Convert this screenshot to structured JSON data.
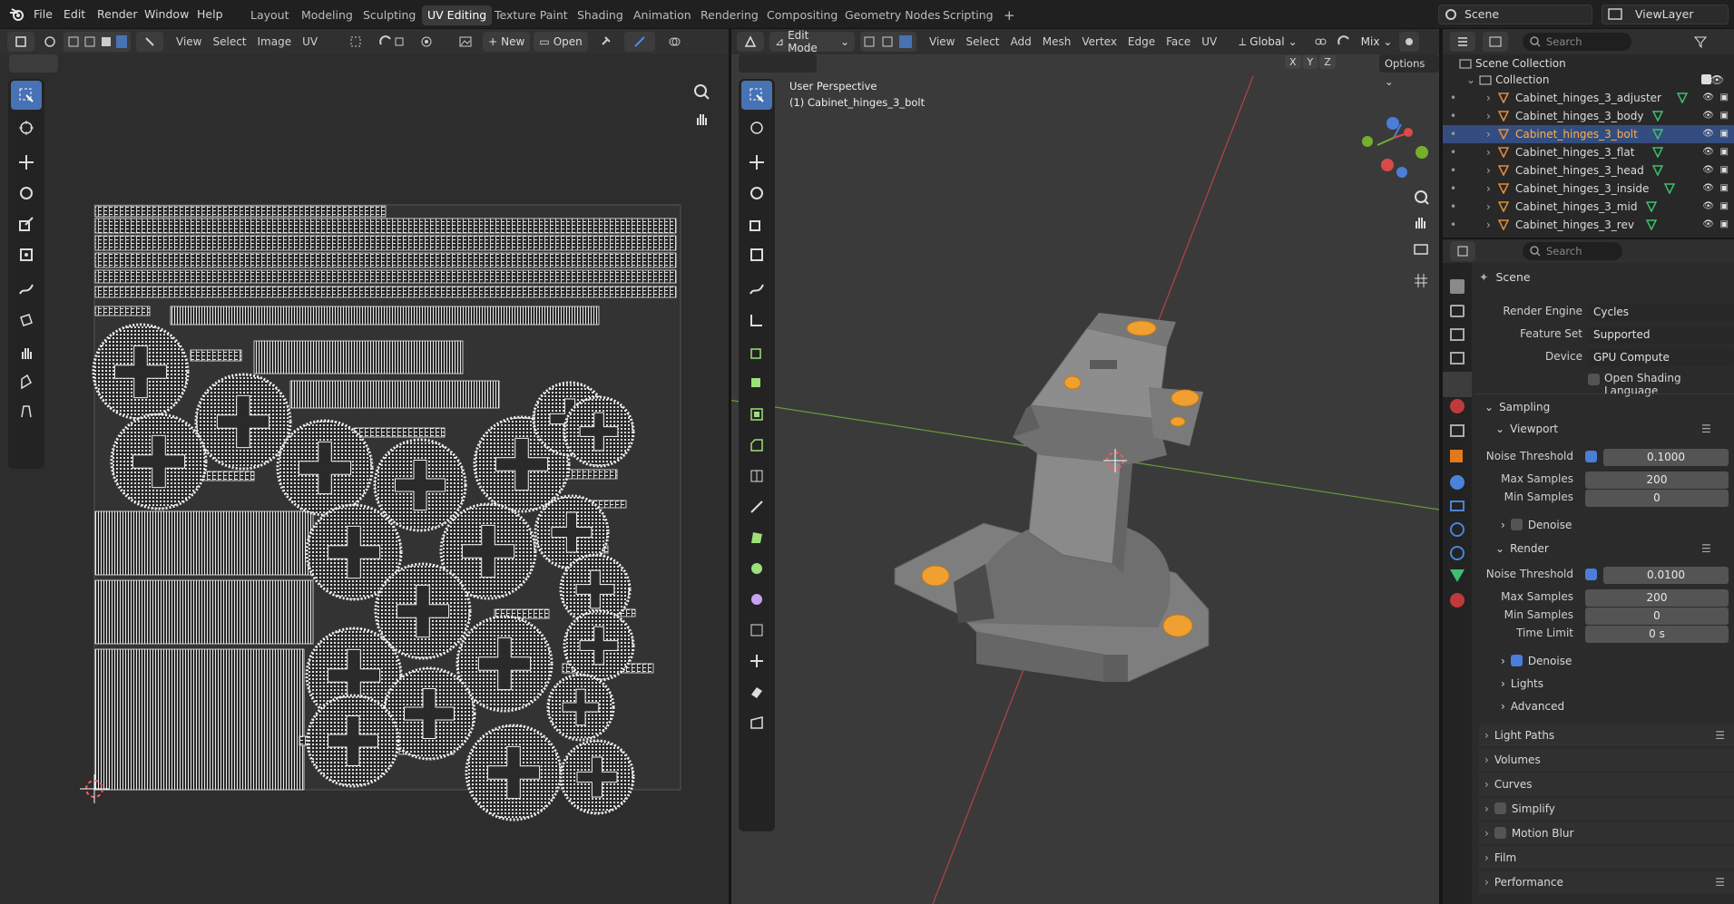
{
  "topbar": {
    "menus": [
      "File",
      "Edit",
      "Render",
      "Window",
      "Help"
    ],
    "workspaces": [
      "Layout",
      "Modeling",
      "Sculpting",
      "UV Editing",
      "Texture Paint",
      "Shading",
      "Animation",
      "Rendering",
      "Compositing",
      "Geometry Nodes",
      "Scripting"
    ],
    "active_workspace": "UV Editing",
    "add_tab": "+",
    "scene": "Scene",
    "view_layer": "ViewLayer"
  },
  "uv_editor": {
    "menus": [
      "View",
      "Select",
      "Image",
      "UV"
    ],
    "new_label": "New",
    "open_label": "Open"
  },
  "viewport": {
    "mode": "Edit Mode",
    "menus": [
      "View",
      "Select",
      "Add",
      "Mesh",
      "Vertex",
      "Edge",
      "Face",
      "UV"
    ],
    "orientation": "Global",
    "proportional_mix": "Mix",
    "options": "Options",
    "view_name": "User Perspective",
    "object_name": "(1) Cabinet_hinges_3_bolt",
    "axes": [
      "X",
      "Y",
      "Z"
    ]
  },
  "outliner": {
    "search_placeholder": "Search",
    "root": "Scene Collection",
    "collection": "Collection",
    "items": [
      {
        "name": "Cabinet_hinges_3_adjuster",
        "selected": false
      },
      {
        "name": "Cabinet_hinges_3_body",
        "selected": false
      },
      {
        "name": "Cabinet_hinges_3_bolt",
        "selected": true
      },
      {
        "name": "Cabinet_hinges_3_flat",
        "selected": false
      },
      {
        "name": "Cabinet_hinges_3_head",
        "selected": false
      },
      {
        "name": "Cabinet_hinges_3_inside",
        "selected": false
      },
      {
        "name": "Cabinet_hinges_3_mid",
        "selected": false
      },
      {
        "name": "Cabinet_hinges_3_rev",
        "selected": false
      }
    ]
  },
  "properties": {
    "search_placeholder": "Search",
    "context": "Scene",
    "render_engine_label": "Render Engine",
    "render_engine": "Cycles",
    "feature_set_label": "Feature Set",
    "feature_set": "Supported",
    "device_label": "Device",
    "device": "GPU Compute",
    "osl_label": "Open Shading Language",
    "sampling": "Sampling",
    "viewport_section": "Viewport",
    "render_section": "Render",
    "noise_threshold_label": "Noise Threshold",
    "max_samples_label": "Max Samples",
    "min_samples_label": "Min Samples",
    "time_limit_label": "Time Limit",
    "denoise_label": "Denoise",
    "viewport": {
      "noise_threshold": "0.1000",
      "max_samples": "200",
      "min_samples": "0"
    },
    "render": {
      "noise_threshold": "0.0100",
      "max_samples": "200",
      "min_samples": "0",
      "time_limit": "0 s"
    },
    "subpanels": [
      "Lights",
      "Advanced"
    ],
    "panels": [
      "Light Paths",
      "Volumes",
      "Curves",
      "Simplify",
      "Motion Blur",
      "Film",
      "Performance"
    ]
  },
  "colors": {
    "accent": "#4772b3",
    "selected_row": "#334d80",
    "object_orange": "#f0a030"
  }
}
